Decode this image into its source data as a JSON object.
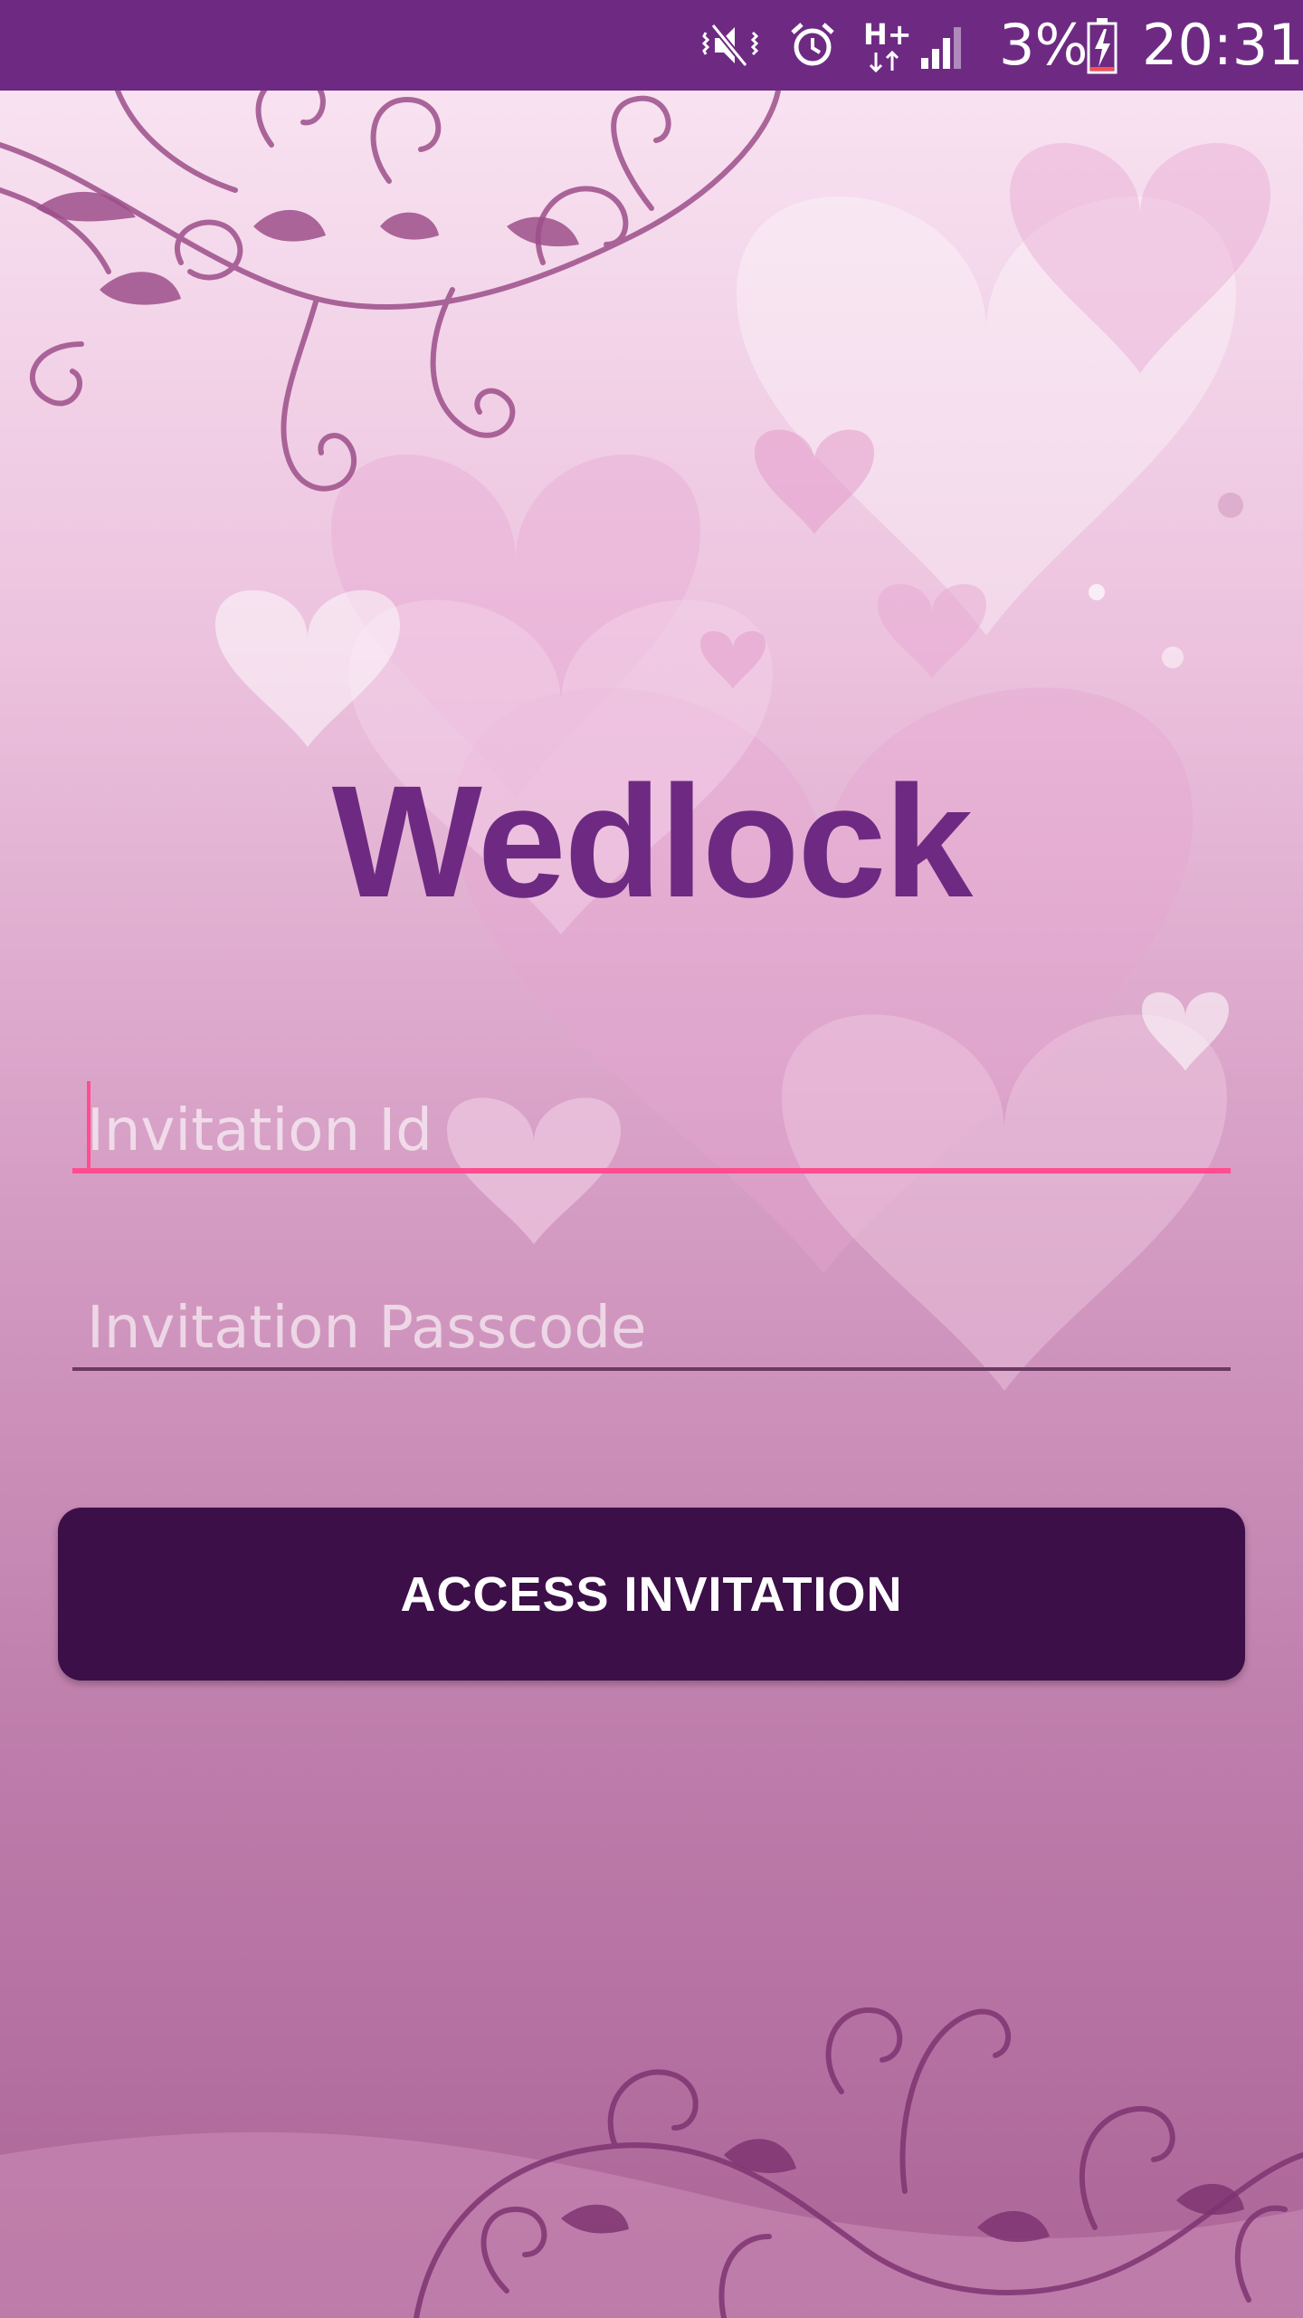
{
  "status_bar": {
    "battery_percent": "3%",
    "time": "20:31",
    "network_type": "H+",
    "icons": [
      "mute-vibrate-icon",
      "alarm-icon",
      "network-type-icon",
      "signal-icon",
      "battery-charging-icon"
    ]
  },
  "app": {
    "title": "Wedlock"
  },
  "form": {
    "invitation_id": {
      "placeholder": "Invitation Id",
      "value": ""
    },
    "passcode": {
      "placeholder": "Invitation Passcode",
      "value": ""
    },
    "submit_label": "ACCESS INVITATION"
  },
  "colors": {
    "status_bar": "#6e2a82",
    "title": "#6e2a82",
    "button": "#3d0f49",
    "focused_underline": "#ff4d8f",
    "background_top": "#f7dff0",
    "background_bottom": "#af6a9a"
  }
}
